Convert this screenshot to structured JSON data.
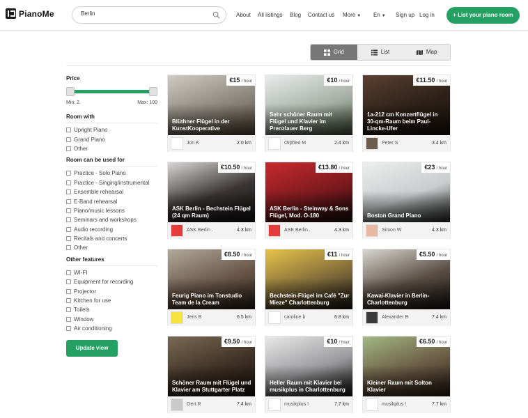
{
  "app": {
    "name": "PianoMe"
  },
  "search": {
    "value": "Berlin",
    "icon": "search-icon"
  },
  "nav": {
    "about": "About",
    "all_listings": "All listings",
    "blog": "Blog",
    "contact": "Contact us",
    "more": "More",
    "language": "En",
    "signup": "Sign up",
    "login": "Log in",
    "list_piano": "+ List your piano room"
  },
  "views": {
    "grid": "Grid",
    "list": "List",
    "map": "Map"
  },
  "filters": {
    "price_title": "Price",
    "min_label": "Min: 2",
    "max_label": "Max: 100",
    "room_with_title": "Room with",
    "room_with": [
      "Upright Piano",
      "Grand Piano",
      "Other"
    ],
    "used_for_title": "Room can be used for",
    "used_for": [
      "Practice - Solo Piano",
      "Practice - Singing/instrumental",
      "Ensemble rehearsal",
      "E-Band rehearsal",
      "Piano/music lessons",
      "Seminars and workshops",
      "Audio recording",
      "Recitals and concerts",
      "Other"
    ],
    "features_title": "Other features",
    "features": [
      "WI-FI",
      "Equipment for recording",
      "Projector",
      "Kitchen for use",
      "Toilets",
      "Window",
      "Air conditioning"
    ],
    "update_button": "Update view"
  },
  "per_hour": "/ hour",
  "listings": [
    {
      "title": "Blüthner Flügel in der KunstKooperative",
      "price": "€15",
      "owner": "Jon K",
      "distance": "2.0 km"
    },
    {
      "title": "Sehr schöner Raum mit Flügel und Klavier im Prenzlauer Berg",
      "price": "€10",
      "owner": "Orpheo M",
      "distance": "2.4 km"
    },
    {
      "title": "1a-212 cm Konzertflügel in 30-qm-Raum beim Paul-Lincke-Ufer",
      "price": "€11.50",
      "owner": "Peter S",
      "distance": "3.4 km"
    },
    {
      "title": "ASK Berlin - Bechstein Flügel (24 qm Raum)",
      "price": "€10.50",
      "owner": "ASK Berlin .",
      "distance": "4.3 km"
    },
    {
      "title": "ASK Berlin - Steinway & Sons Flügel, Mod. O-180",
      "price": "€13.80",
      "owner": "ASK Berlin .",
      "distance": "4.3 km"
    },
    {
      "title": "Boston Grand Piano",
      "price": "€23",
      "owner": "Simon W",
      "distance": "4.3 km"
    },
    {
      "title": "Feurig Piano im Tonstudio Team de la Cream",
      "price": "€8.50",
      "owner": "Jens B",
      "distance": "6.5 km"
    },
    {
      "title": "Bechstein-Flügel im Café \"Zur Mieze\" Charlottenburg",
      "price": "€11",
      "owner": "caroline b",
      "distance": "6.8 km"
    },
    {
      "title": "Kawai-Klavier in Berlin-Charlottenburg",
      "price": "€5.50",
      "owner": "Alexander B",
      "distance": "7.4 km"
    },
    {
      "title": "Schöner Raum mit Flügel und Klavier am Stuttgarter Platz",
      "price": "€9.50",
      "owner": "Gert R",
      "distance": "7.4 km"
    },
    {
      "title": "Heller Raum mit Klavier bei musikplus in Charlottenburg",
      "price": "€10",
      "owner": "musikplus !",
      "distance": "7.7 km"
    },
    {
      "title": "Kleiner Raum mit Solton Klavier",
      "price": "€6.50",
      "owner": "musikplus !",
      "distance": "7.7 km"
    }
  ],
  "colors": {
    "brand_green": "#25a063",
    "active_view": "#777777"
  }
}
